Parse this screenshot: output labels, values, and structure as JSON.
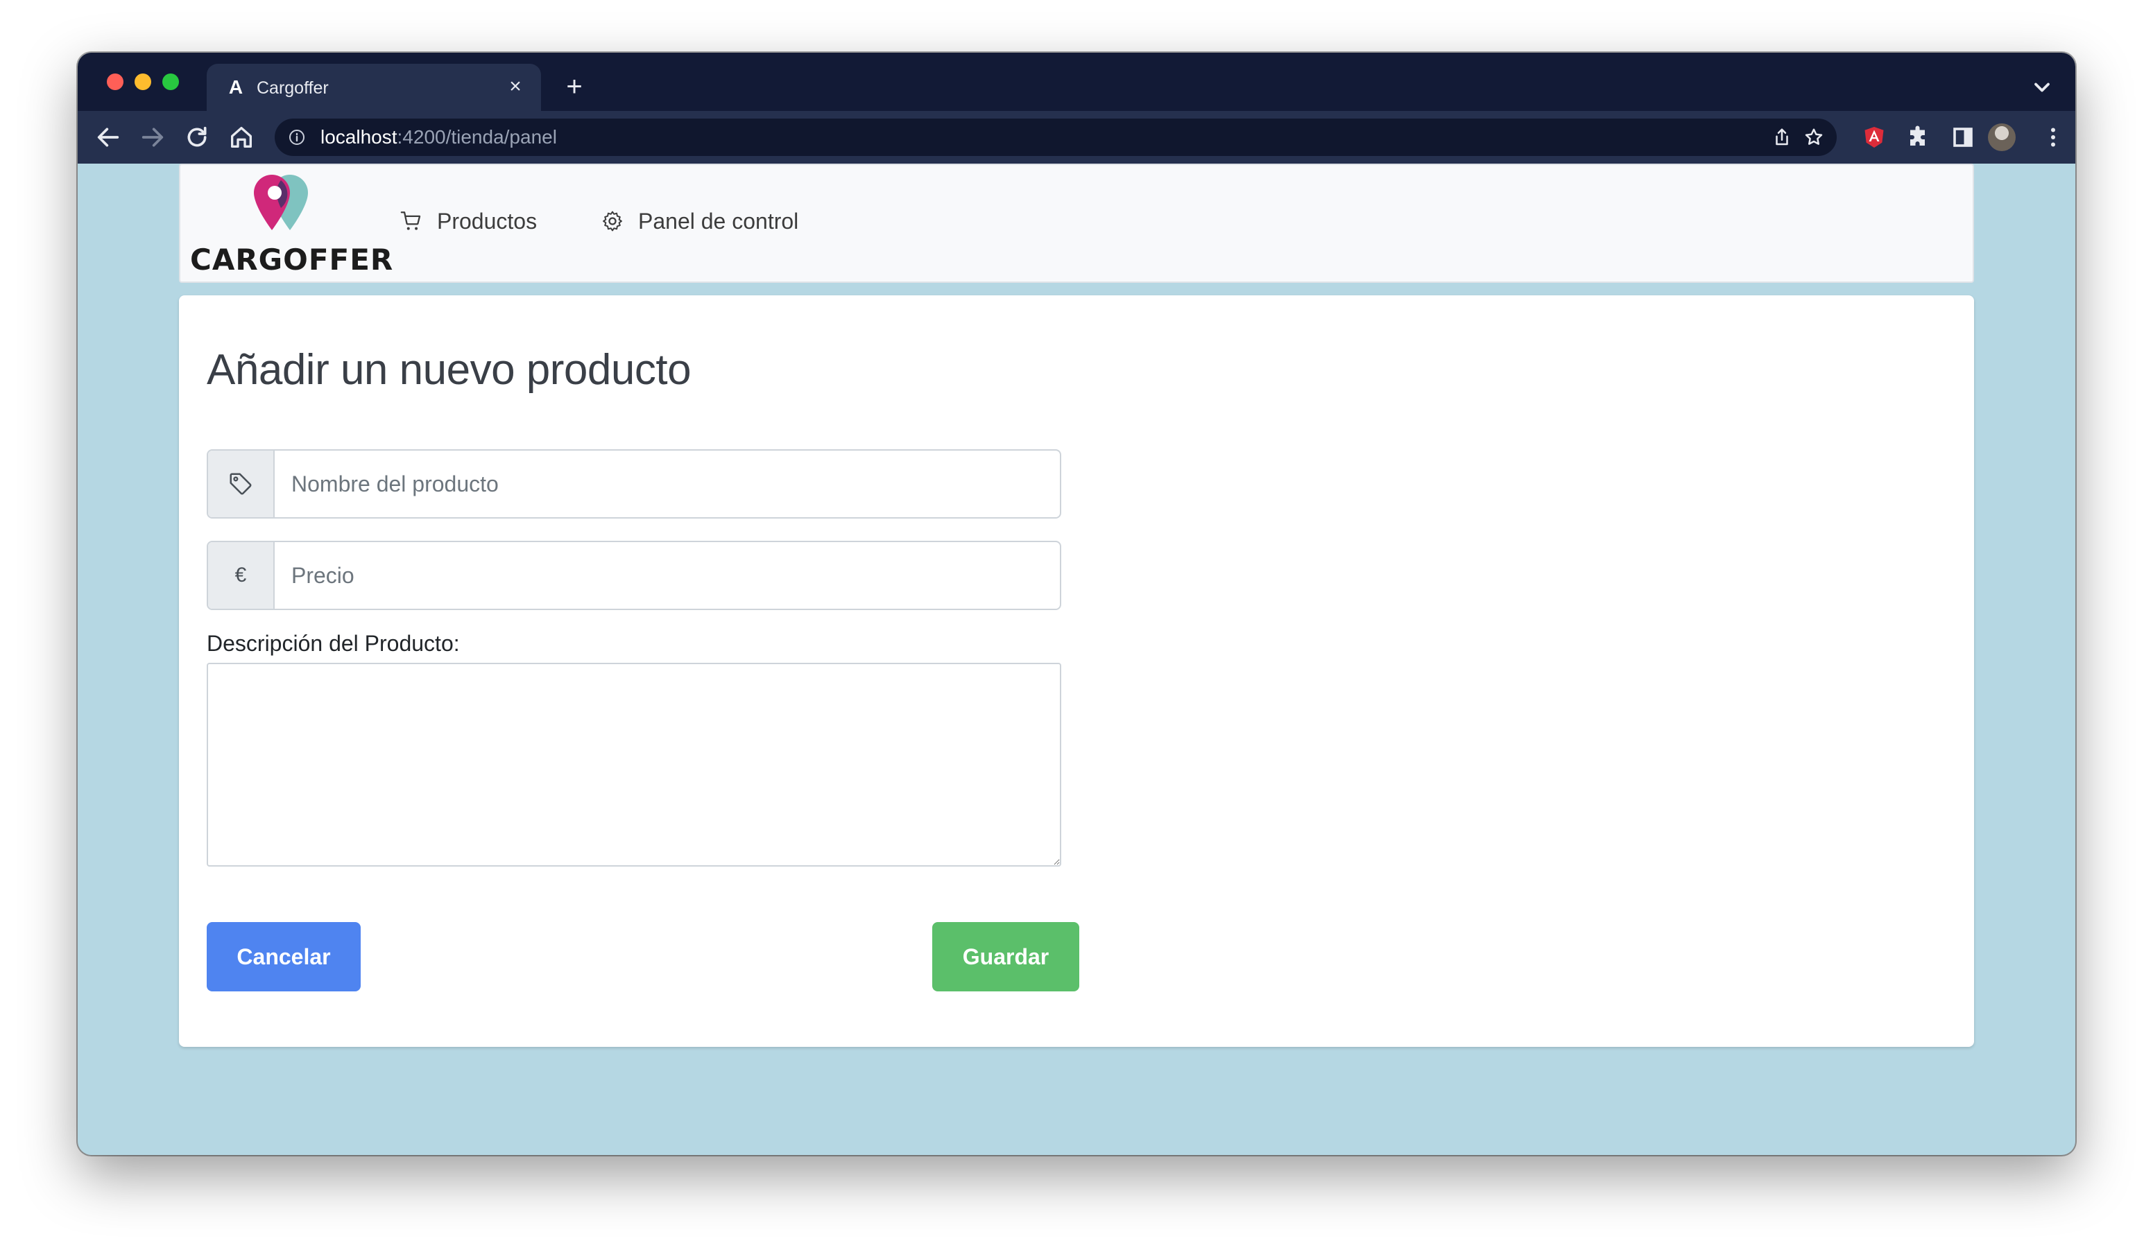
{
  "browser": {
    "tab_title": "Cargoffer",
    "tab_favicon": "A",
    "close_tab": "×",
    "new_tab": "+",
    "url_host": "localhost",
    "url_path": ":4200/tienda/panel"
  },
  "navbar": {
    "logo_text": "CARGOFFER",
    "items": [
      {
        "label": "Productos",
        "icon": "cart-icon"
      },
      {
        "label": "Panel de control",
        "icon": "gear-icon"
      }
    ]
  },
  "form": {
    "title": "Añadir un nuevo producto",
    "name_placeholder": "Nombre del producto",
    "name_value": "",
    "price_addon": "€",
    "price_placeholder": "Precio",
    "price_value": "",
    "description_label": "Descripción del Producto:",
    "description_value": "",
    "cancel_label": "Cancelar",
    "save_label": "Guardar"
  },
  "colors": {
    "page_background": "#b5d7e3",
    "cancel_button": "#4f84f0",
    "save_button": "#5bbf6a",
    "logo_magenta": "#d0287a",
    "logo_teal": "#7fc3c0"
  }
}
